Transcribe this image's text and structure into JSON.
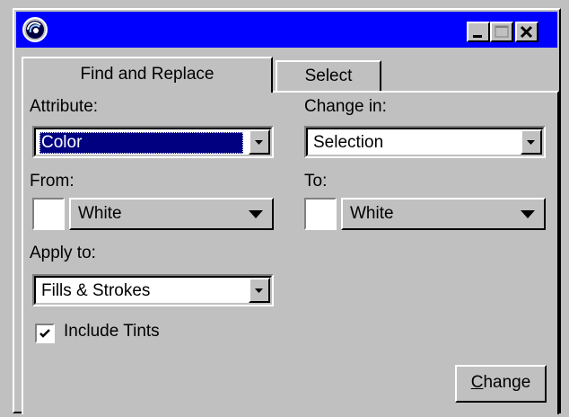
{
  "window": {
    "title": ""
  },
  "titlebar_buttons": {
    "minimize": "minimize-icon",
    "maximize": "maximize-icon",
    "close": "close-icon"
  },
  "tabs": [
    {
      "label": "Find and Replace",
      "active": true
    },
    {
      "label": "Select",
      "active": false
    }
  ],
  "attribute": {
    "label": "Attribute:",
    "value": "Color"
  },
  "change_in": {
    "label": "Change in:",
    "value": "Selection"
  },
  "from": {
    "label": "From:",
    "value": "White",
    "swatch_color": "#ffffff"
  },
  "to": {
    "label": "To:",
    "value": "White",
    "swatch_color": "#ffffff"
  },
  "apply_to": {
    "label": "Apply to:",
    "value": "Fills & Strokes"
  },
  "include_tints": {
    "label": "Include Tints",
    "checked": true
  },
  "change_button": {
    "mnemonic": "C",
    "rest": "hange"
  },
  "colors": {
    "titlebar": "#0000ff",
    "selection": "#000080",
    "face": "#c0c0c0"
  }
}
